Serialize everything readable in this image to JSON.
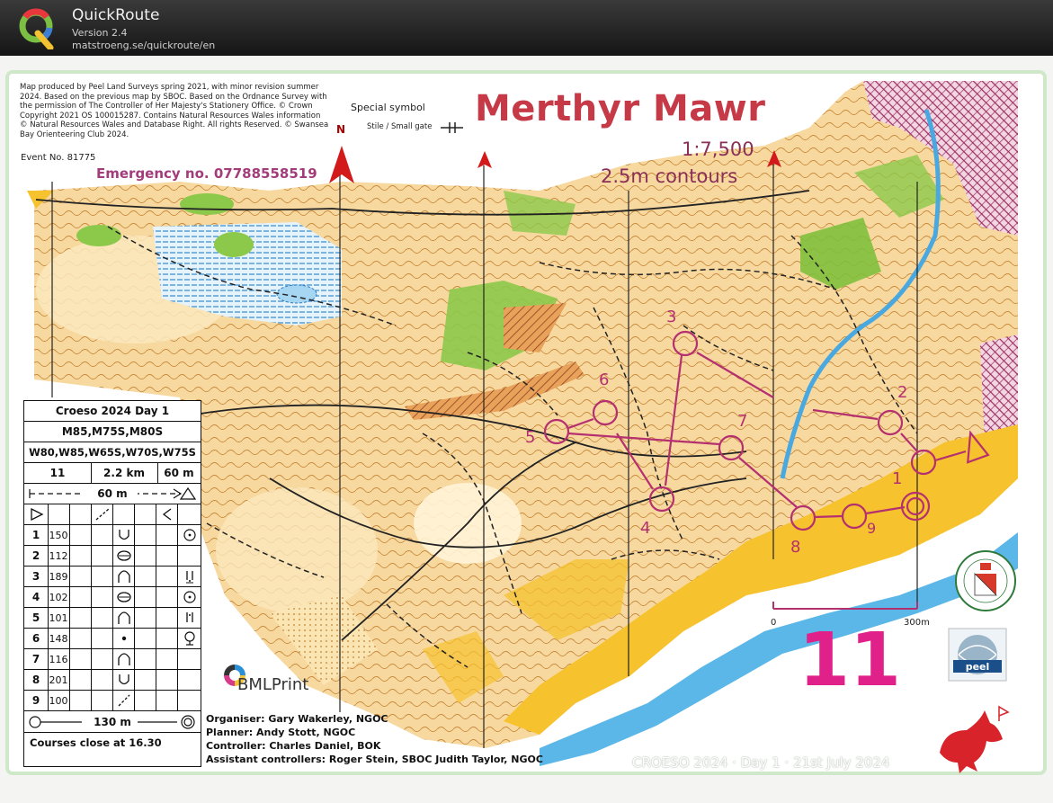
{
  "app": {
    "title": "QuickRoute",
    "version": "Version 2.4",
    "url": "matstroeng.se/quickroute/en",
    "logo_icon": "quickroute-q-logo-icon"
  },
  "map": {
    "title": "Merthyr Mawr",
    "scale": "1:7,500",
    "contours": "2.5m contours",
    "credits": "Map produced by Peel Land Surveys spring 2021, with minor revision summer 2024. Based on the previous map by SBOC. Based on the Ordnance Survey with the permission of The Controller of Her Majesty's Stationery Office. © Crown Copyright 2021 OS 100015287. Contains Natural Resources Wales information © Natural Resources Wales and Database Right. All rights Reserved. © Swansea Bay Orienteering Club 2024.",
    "event_no": "Event No. 81775",
    "emergency": "Emergency no. 07788558519",
    "special_symbol_title": "Special symbol",
    "special_symbol_item": "Stile / Small gate",
    "north_label": "N",
    "course_number": "11",
    "scale_bar": {
      "start": "0",
      "end": "300m"
    },
    "footer_banner": "CROESO 2024 · Day 1 · 21st July 2024",
    "sponsor": "BMLPrint",
    "colors": {
      "course": "#b5306f",
      "title": "#c63a48",
      "water": "#5bb7e8",
      "sand": "#f6c22e",
      "forest": "#7fbf3b"
    }
  },
  "officials": {
    "organiser": "Organiser: Gary Wakerley, NGOC",
    "planner": "Planner: Andy Stott, NGOC",
    "controller": "Controller: Charles Daniel, BOK",
    "assistant": "Assistant controllers: Roger Stein, SBOC  Judith Taylor,  NGOC"
  },
  "controls": [
    {
      "number": "1"
    },
    {
      "number": "2"
    },
    {
      "number": "3"
    },
    {
      "number": "4"
    },
    {
      "number": "5"
    },
    {
      "number": "6"
    },
    {
      "number": "7"
    },
    {
      "number": "8"
    },
    {
      "number": "9"
    }
  ],
  "description_sheet": {
    "event": "Croeso 2024 Day 1",
    "classes_line1": "M85,M75S,M80S",
    "classes_line2": "W80,W85,W65S,W70S,W75S",
    "course": "11",
    "length": "2.2 km",
    "climb": "60 m",
    "start_to_map": "60 m",
    "finish_dist": "130 m",
    "rows": [
      {
        "n": "1",
        "code": "150"
      },
      {
        "n": "2",
        "code": "112"
      },
      {
        "n": "3",
        "code": "189"
      },
      {
        "n": "4",
        "code": "102"
      },
      {
        "n": "5",
        "code": "101"
      },
      {
        "n": "6",
        "code": "148"
      },
      {
        "n": "7",
        "code": "116"
      },
      {
        "n": "8",
        "code": "201"
      },
      {
        "n": "9",
        "code": "100"
      }
    ],
    "closing": "Courses close at 16.30"
  }
}
